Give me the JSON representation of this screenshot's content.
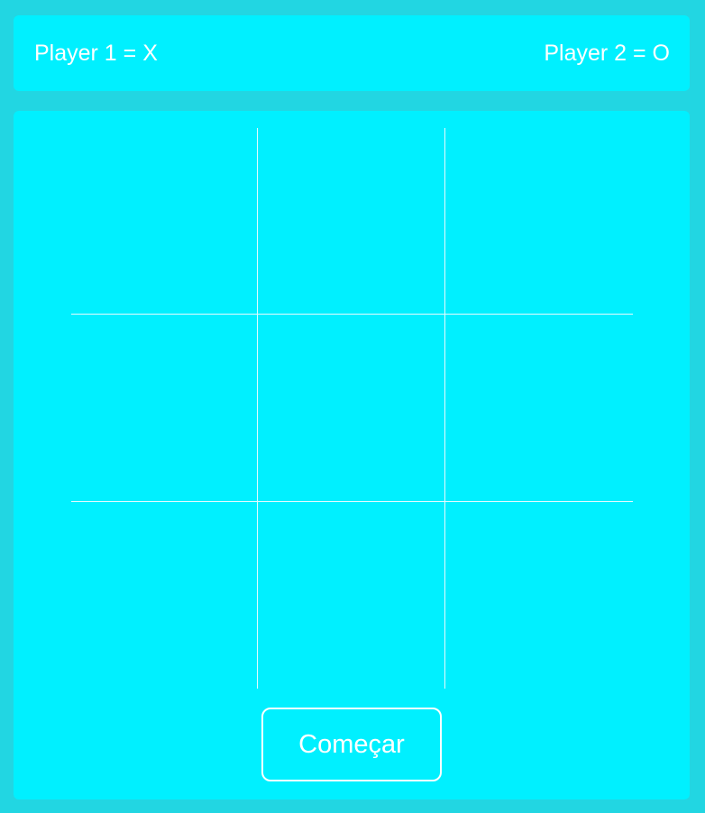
{
  "header": {
    "player1": "Player 1 = X",
    "player2": "Player 2 = O"
  },
  "board": {
    "cells": [
      "",
      "",
      "",
      "",
      "",
      "",
      "",
      "",
      ""
    ]
  },
  "start_button": {
    "label": "Começar"
  },
  "colors": {
    "page_background": "#22d6e2",
    "panel_background": "#00f0ff",
    "text": "#ffffff",
    "grid_line": "#e6fbff"
  }
}
